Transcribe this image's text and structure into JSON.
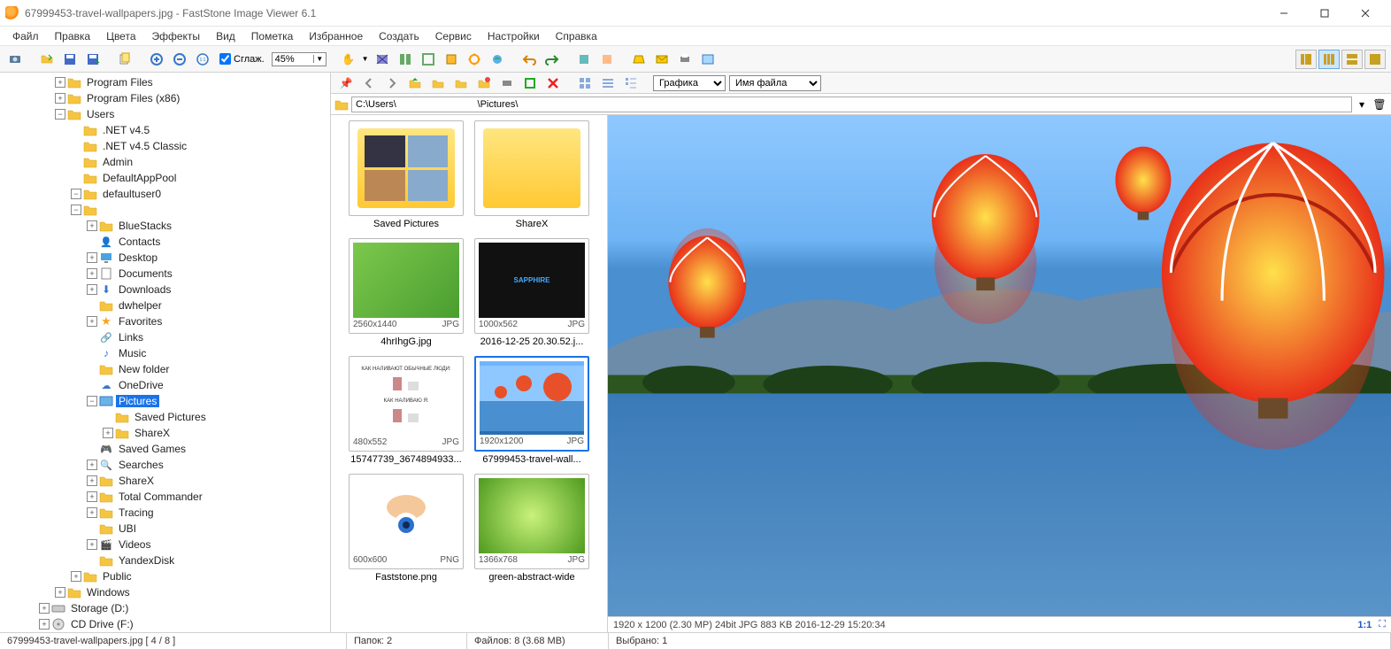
{
  "titlebar": {
    "title": "67999453-travel-wallpapers.jpg  -  FastStone Image Viewer 6.1"
  },
  "menu": [
    "Файл",
    "Правка",
    "Цвета",
    "Эффекты",
    "Вид",
    "Пометка",
    "Избранное",
    "Создать",
    "Сервис",
    "Настройки",
    "Справка"
  ],
  "toolbar": {
    "smooth_label": "Сглаж.",
    "zoom_value": "45%"
  },
  "subtoolbar": {
    "render_mode": "Графика",
    "sort_by": "Имя файла"
  },
  "path": "C:\\Users\\                              \\Pictures\\",
  "tree": [
    {
      "depth": 2,
      "exp": "+",
      "ico": "folder",
      "label": "Program Files"
    },
    {
      "depth": 2,
      "exp": "+",
      "ico": "folder",
      "label": "Program Files (x86)"
    },
    {
      "depth": 2,
      "exp": "-",
      "ico": "folder",
      "label": "Users"
    },
    {
      "depth": 3,
      "exp": " ",
      "ico": "folder",
      "label": ".NET v4.5"
    },
    {
      "depth": 3,
      "exp": " ",
      "ico": "folder",
      "label": ".NET v4.5 Classic"
    },
    {
      "depth": 3,
      "exp": " ",
      "ico": "folder",
      "label": "Admin"
    },
    {
      "depth": 3,
      "exp": " ",
      "ico": "folder",
      "label": "DefaultAppPool"
    },
    {
      "depth": 3,
      "exp": "-",
      "ico": "folder",
      "label": "defaultuser0"
    },
    {
      "depth": 3,
      "exp": "-",
      "ico": "folder",
      "label": ""
    },
    {
      "depth": 4,
      "exp": "+",
      "ico": "folder",
      "label": "BlueStacks"
    },
    {
      "depth": 4,
      "exp": " ",
      "ico": "contacts",
      "label": "Contacts"
    },
    {
      "depth": 4,
      "exp": "+",
      "ico": "desktop",
      "label": "Desktop"
    },
    {
      "depth": 4,
      "exp": "+",
      "ico": "docs",
      "label": "Documents"
    },
    {
      "depth": 4,
      "exp": "+",
      "ico": "down",
      "label": "Downloads"
    },
    {
      "depth": 4,
      "exp": " ",
      "ico": "folder",
      "label": "dwhelper"
    },
    {
      "depth": 4,
      "exp": "+",
      "ico": "fav",
      "label": "Favorites"
    },
    {
      "depth": 4,
      "exp": " ",
      "ico": "link",
      "label": "Links"
    },
    {
      "depth": 4,
      "exp": " ",
      "ico": "music",
      "label": "Music"
    },
    {
      "depth": 4,
      "exp": " ",
      "ico": "folder",
      "label": "New folder"
    },
    {
      "depth": 4,
      "exp": " ",
      "ico": "cloud",
      "label": "OneDrive"
    },
    {
      "depth": 4,
      "exp": "-",
      "ico": "pics",
      "label": "Pictures",
      "selected": true
    },
    {
      "depth": 5,
      "exp": " ",
      "ico": "folder",
      "label": "Saved Pictures"
    },
    {
      "depth": 5,
      "exp": "+",
      "ico": "folder",
      "label": "ShareX"
    },
    {
      "depth": 4,
      "exp": " ",
      "ico": "games",
      "label": "Saved Games"
    },
    {
      "depth": 4,
      "exp": "+",
      "ico": "search",
      "label": "Searches"
    },
    {
      "depth": 4,
      "exp": "+",
      "ico": "folder",
      "label": "ShareX"
    },
    {
      "depth": 4,
      "exp": "+",
      "ico": "folder",
      "label": "Total Commander"
    },
    {
      "depth": 4,
      "exp": "+",
      "ico": "folder",
      "label": "Tracing"
    },
    {
      "depth": 4,
      "exp": " ",
      "ico": "folder",
      "label": "UBI"
    },
    {
      "depth": 4,
      "exp": "+",
      "ico": "video",
      "label": "Videos"
    },
    {
      "depth": 4,
      "exp": " ",
      "ico": "folder",
      "label": "YandexDisk"
    },
    {
      "depth": 3,
      "exp": "+",
      "ico": "folder",
      "label": "Public"
    },
    {
      "depth": 2,
      "exp": "+",
      "ico": "folder",
      "label": "Windows"
    },
    {
      "depth": 1,
      "exp": "+",
      "ico": "drive",
      "label": "Storage (D:)"
    },
    {
      "depth": 1,
      "exp": "+",
      "ico": "cd",
      "label": "CD Drive (F:)"
    }
  ],
  "thumbs": [
    {
      "type": "folder",
      "name": "Saved Pictures",
      "previews": 4
    },
    {
      "type": "folder",
      "name": "ShareX",
      "previews": 0
    },
    {
      "type": "img",
      "name": "4hrIhgG.jpg",
      "dims": "2560x1440",
      "ext": "JPG",
      "fill": "linear-gradient(135deg,#7cc84d,#4a9e2f)"
    },
    {
      "type": "img",
      "name": "2016-12-25 20.30.52.j...",
      "dims": "1000x562",
      "ext": "JPG",
      "fill": "#1a1a1a"
    },
    {
      "type": "img",
      "name": "15747739_3674894933...",
      "dims": "480x552",
      "ext": "JPG",
      "fill": "#ffffff"
    },
    {
      "type": "img",
      "name": "67999453-travel-wall...",
      "dims": "1920x1200",
      "ext": "JPG",
      "fill": "linear-gradient(#6fb4ff 40%,#2b6fb3 60%)",
      "selected": true
    },
    {
      "type": "img",
      "name": "Faststone.png",
      "dims": "600x600",
      "ext": "PNG",
      "fill": "#ffffff"
    },
    {
      "type": "img",
      "name": "green-abstract-wide",
      "dims": "1366x768",
      "ext": "JPG",
      "fill": "radial-gradient(circle,#c9f27a,#4e9a1f)"
    }
  ],
  "preview_status": {
    "left": "1920 x 1200 (2.30 MP)  24bit  JPG  883 KB  2016-12-29 15:20:34",
    "ratio": "1:1"
  },
  "statusbar": {
    "file": "67999453-travel-wallpapers.jpg [ 4 / 8 ]",
    "folders": "Папок: 2",
    "files": "Файлов: 8 (3.68 MB)",
    "selected": "Выбрано: 1"
  }
}
